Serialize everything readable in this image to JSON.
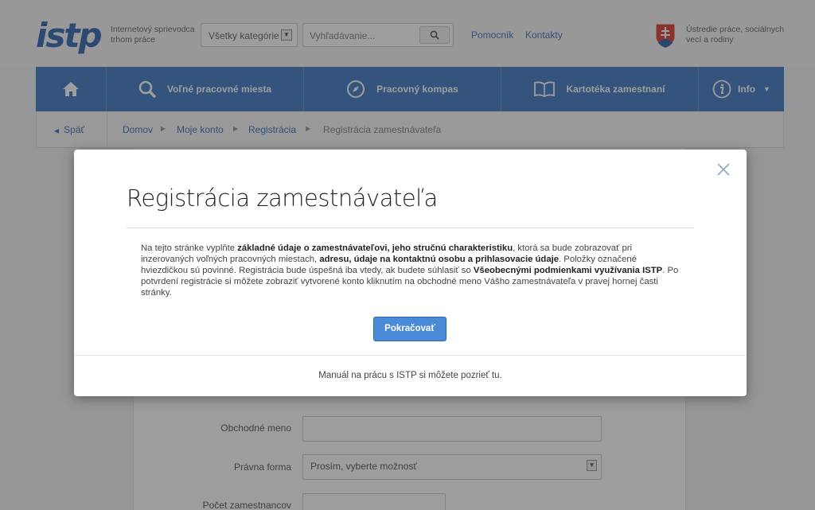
{
  "header": {
    "logo": "istp",
    "tagline": "Internetový sprievodca trhom práce",
    "category_select": "Všetky kategórie",
    "search_placeholder": "Vyhľadávanie...",
    "links": [
      "Pomocník",
      "Kontakty"
    ],
    "ministry": "Ústredie práce, sociálnych vecí a rodiny"
  },
  "nav": {
    "items": [
      {
        "label": "",
        "icon": "home-icon"
      },
      {
        "label": "Voľné pracovné miesta",
        "icon": "search-icon"
      },
      {
        "label": "Pracovný kompas",
        "icon": "compass-icon"
      },
      {
        "label": "Kartotéka zamestnaní",
        "icon": "book-icon"
      },
      {
        "label": "Info",
        "icon": "info-icon"
      }
    ]
  },
  "breadcrumb": {
    "back": "Späť",
    "items": [
      "Domov",
      "Moje konto",
      "Registrácia",
      "Registrácia zamestnávateľa"
    ]
  },
  "form": {
    "fields": [
      {
        "label": "Obchodné meno",
        "value": ""
      },
      {
        "label": "Právna forma",
        "value": "Prosím, vyberte možnosť"
      },
      {
        "label": "Počet zamestnancov",
        "value": ""
      }
    ]
  },
  "modal": {
    "title": "Registrácia zamestnávateľa",
    "body": {
      "t1": "Na tejto stránke vyplňte ",
      "b1": "základné údaje o zamestnávateľovi, jeho stručnú charakteristiku",
      "t2": ", ktorá sa bude zobrazovať pri inzerovaných voľných pracovných miestach, ",
      "b2": "adresu, údaje na kontaktnú osobu a prihlasovacie údaje",
      "t3": ". Položky označené hviezdičkou sú povinné. Registrácia bude úspešná iba vtedy, ak budete súhlasiť so ",
      "b3": "Všeobecnými podmienkami využívania ISTP",
      "t4": ". Po potvrdení registrácie si môžete zobraziť vytvorené konto kliknutím na obchodné meno Vášho zamestnávateľa v pravej hornej časti stránky."
    },
    "continue_label": "Pokračovať",
    "footer": "Manuál na prácu s ISTP si môžete pozrieť tu."
  },
  "colors": {
    "brand_blue": "#2d6cc0",
    "link_blue": "#2b64b2",
    "button_blue": "#4a8ad6"
  }
}
